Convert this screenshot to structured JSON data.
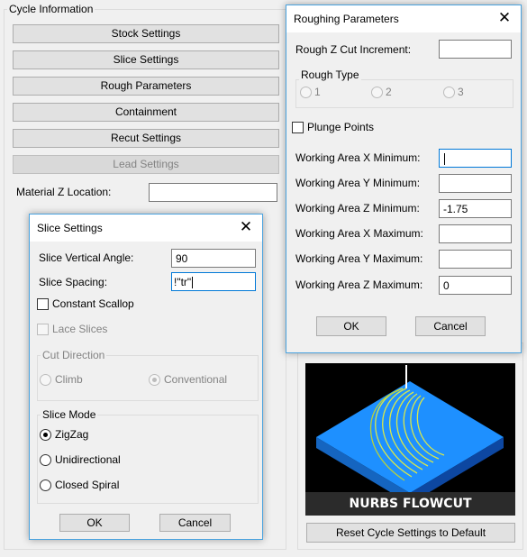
{
  "cycle_info": {
    "title": "Cycle Information",
    "buttons": [
      "Stock Settings",
      "Slice Settings",
      "Rough Parameters",
      "Containment",
      "Recut Settings",
      "Lead Settings"
    ],
    "material_z_label": "Material Z Location:",
    "material_z_value": "",
    "reset_label": "Reset Cycle Settings to Default",
    "image_caption": "NURBS FLOWCUT"
  },
  "roughing": {
    "title": "Roughing Parameters",
    "close_glyph": "✕",
    "rough_z_label": "Rough Z Cut Increment:",
    "rough_z_value": "",
    "rough_type_title": "Rough Type",
    "rough_type_options": [
      "1",
      "2",
      "3"
    ],
    "plunge_label": "Plunge Points",
    "fields": [
      {
        "label": "Working Area X Minimum:",
        "value": ""
      },
      {
        "label": "Working Area Y Minimum:",
        "value": ""
      },
      {
        "label": "Working Area Z Minimum:",
        "value": "-1.75"
      },
      {
        "label": "Working Area X Maximum:",
        "value": ""
      },
      {
        "label": "Working Area Y Maximum:",
        "value": ""
      },
      {
        "label": "Working Area Z Maximum:",
        "value": "0"
      }
    ],
    "ok_label": "OK",
    "cancel_label": "Cancel"
  },
  "slice": {
    "title": "Slice Settings",
    "close_glyph": "✕",
    "vertical_angle_label": "Slice Vertical Angle:",
    "vertical_angle_value": "90",
    "spacing_label": "Slice Spacing:",
    "spacing_value": "!\"tr\"",
    "constant_scallop_label": "Constant Scallop",
    "lace_slices_label": "Lace Slices",
    "cut_direction_title": "Cut Direction",
    "cut_direction_options": [
      "Climb",
      "Conventional"
    ],
    "slice_mode_title": "Slice Mode",
    "slice_mode_options": [
      "ZigZag",
      "Unidirectional",
      "Closed Spiral"
    ],
    "slice_mode_selected": "ZigZag",
    "ok_label": "OK",
    "cancel_label": "Cancel"
  },
  "colors": {
    "accent_border": "#4aa3df",
    "stock_blue": "#1e90ff",
    "toolpath_yellow": "#d8e84a"
  }
}
